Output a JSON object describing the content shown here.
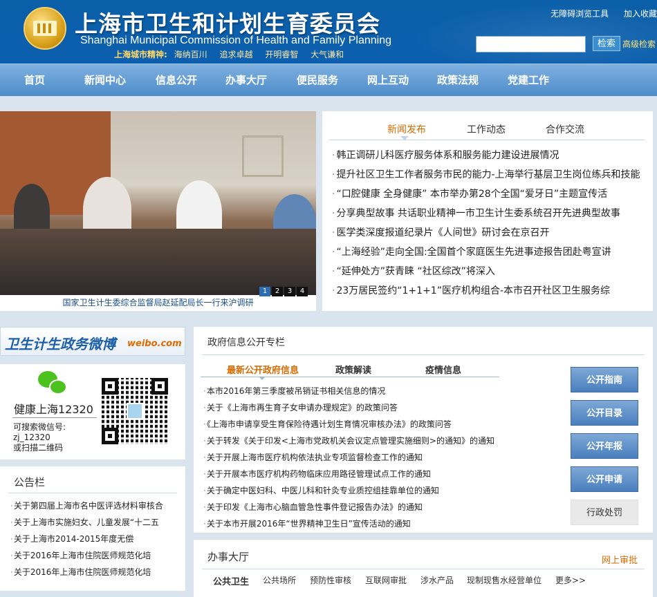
{
  "header": {
    "title_cn": "上海市卫生和计划生育委员会",
    "title_en": "Shanghai Municipal Commission of Health and Family Planning",
    "spirit_label": "上海城市精神:",
    "spirit_items": [
      "海纳百川",
      "追求卓越",
      "开明睿智",
      "大气谦和"
    ],
    "accessibility_link": "无障碍浏览工具",
    "favorite_link": "加入收藏",
    "search_placeholder": "",
    "search_button": "检索",
    "advanced_search": "高级检索"
  },
  "nav": [
    "首页",
    "新闻中心",
    "信息公开",
    "办事大厅",
    "便民服务",
    "网上互动",
    "政策法规",
    "党建工作"
  ],
  "slideshow": {
    "caption": "国家卫生计生委综合监督局赵延配局长一行来沪调研",
    "pages": [
      "1",
      "2",
      "3",
      "4"
    ],
    "active_page": 1
  },
  "news": {
    "tabs": [
      "新闻发布",
      "工作动态",
      "合作交流"
    ],
    "active_tab": "新闻发布",
    "items": [
      "韩正调研儿科医疗服务体系和服务能力建设进展情况",
      "提升社区卫生工作者服务市民的能力-上海举行基层卫生岗位练兵和技能",
      "“口腔健康 全身健康” 本市举办第28个全国“爱牙日”主题宣传活",
      "分享典型故事 共话职业精神一市卫生计生委系统召开先进典型故事",
      "医学类深度报道纪录片《人间世》研讨会在京召开",
      "“上海经验”走向全国:全国首个家庭医生先进事迹报告团赴粤宣讲",
      "“延伸处方”获青睐 “社区综改”将深入",
      "23万居民签约“1+1+1”医疗机构组合-本市召开社区卫生服务综"
    ]
  },
  "weibo": {
    "title": "卫生计生政务微博",
    "brand": "weibo.com"
  },
  "wechat": {
    "name": "健康上海12320",
    "hint_line1": "可搜索微信号:",
    "hint_line2": "zj_12320",
    "hint_line3": "或扫描二维码"
  },
  "notice": {
    "title": "公告栏",
    "items": [
      "关于第四届上海市名中医评选材料审核合",
      "关于上海市实施妇女、儿童发展“十二五",
      "关于上海市2014-2015年度无偿",
      "关于2016年上海市住院医师规范化培",
      "关于2016年上海市住院医师规范化培"
    ]
  },
  "gov_info": {
    "title": "政府信息公开专栏",
    "tabs": [
      "最新公开政府信息",
      "政策解读",
      "疫情信息"
    ],
    "active_tab": "最新公开政府信息",
    "items": [
      "本市2016年第三季度被吊销证书相关信息的情况",
      "关于《上海市再生育子女申请办理规定》的政策问答",
      "《上海市申请享受生育保险待遇计划生育情况审核办法》的政策问答",
      "关于转发《关于印发<上海市党政机关会议定点管理实施细则>的通知》的通知",
      "关于开展上海市医疗机构依法执业专项监督检查工作的通知",
      "关于开展本市医疗机构药物临床应用路径管理试点工作的通知",
      "关于确定中医妇科、中医儿科和针灸专业质控组挂靠单位的通知",
      "关于印发《上海市心脑血管急性事件登记报告办法》的通知",
      "关于本市开展2016年“世界精神卫生日”宣传活动的通知"
    ],
    "side_buttons": [
      "公开指南",
      "公开目录",
      "公开年报",
      "公开申请",
      "行政处罚"
    ]
  },
  "service_hall": {
    "title": "办事大厅",
    "online_review": "网上审批",
    "tabs": [
      "公共卫生",
      "公共场所",
      "预防性审核",
      "互联网审批",
      "涉水产品",
      "现制现售水经营单位",
      "更多>>"
    ],
    "active_tab": "公共卫生"
  }
}
